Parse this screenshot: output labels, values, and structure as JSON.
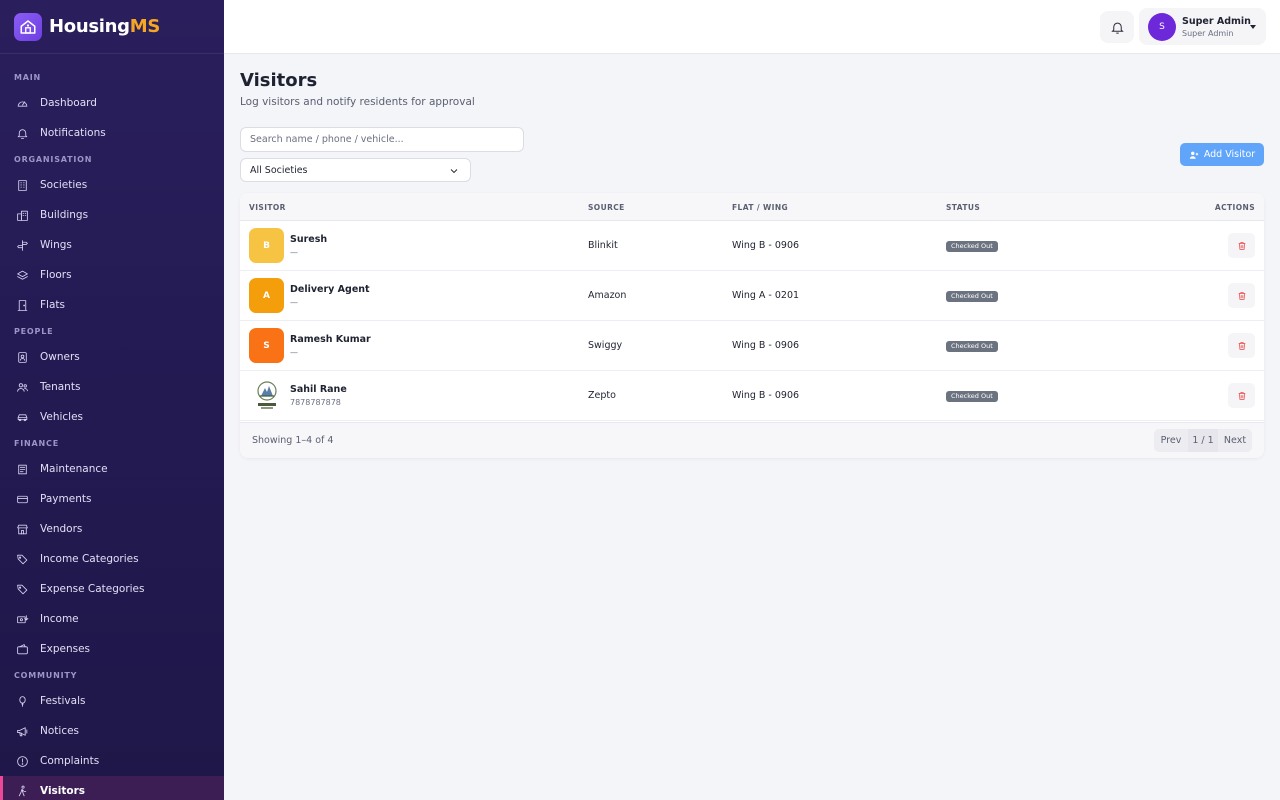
{
  "brand": {
    "name_main": "Housing",
    "name_accent": "MS"
  },
  "sidebar": {
    "sections": [
      {
        "title": "MAIN",
        "items": [
          {
            "label": "Dashboard",
            "icon": "gauge-icon"
          },
          {
            "label": "Notifications",
            "icon": "bell-icon"
          }
        ]
      },
      {
        "title": "ORGANISATION",
        "items": [
          {
            "label": "Societies",
            "icon": "building-icon"
          },
          {
            "label": "Buildings",
            "icon": "city-icon"
          },
          {
            "label": "Wings",
            "icon": "signpost-icon"
          },
          {
            "label": "Floors",
            "icon": "layers-icon"
          },
          {
            "label": "Flats",
            "icon": "door-icon"
          }
        ]
      },
      {
        "title": "PEOPLE",
        "items": [
          {
            "label": "Owners",
            "icon": "id-badge-icon"
          },
          {
            "label": "Tenants",
            "icon": "users-icon"
          },
          {
            "label": "Vehicles",
            "icon": "car-icon"
          }
        ]
      },
      {
        "title": "FINANCE",
        "items": [
          {
            "label": "Maintenance",
            "icon": "receipt-icon"
          },
          {
            "label": "Payments",
            "icon": "credit-card-icon"
          },
          {
            "label": "Vendors",
            "icon": "store-icon"
          },
          {
            "label": "Income Categories",
            "icon": "tags-icon"
          },
          {
            "label": "Expense Categories",
            "icon": "tags-icon"
          },
          {
            "label": "Income",
            "icon": "money-in-icon"
          },
          {
            "label": "Expenses",
            "icon": "wallet-icon"
          }
        ]
      },
      {
        "title": "COMMUNITY",
        "items": [
          {
            "label": "Festivals",
            "icon": "balloon-icon"
          },
          {
            "label": "Notices",
            "icon": "megaphone-icon"
          },
          {
            "label": "Complaints",
            "icon": "alert-circle-icon"
          },
          {
            "label": "Visitors",
            "icon": "person-walking-icon",
            "active": true
          }
        ]
      }
    ]
  },
  "topbar": {
    "user_initial": "S",
    "user_name": "Super Admin",
    "user_role": "Super Admin"
  },
  "main": {
    "title": "Visitors",
    "subtitle": "Log visitors and notify residents for approval",
    "search_placeholder": "Search name / phone / vehicle...",
    "society_filter": "All Societies",
    "add_button": "Add Visitor"
  },
  "table": {
    "headers": {
      "visitor": "VISITOR",
      "source": "SOURCE",
      "flat": "FLAT / WING",
      "status": "STATUS",
      "actions": "ACTIONS"
    },
    "rows": [
      {
        "initial": "B",
        "avatar_color": "#f6c343",
        "name": "Suresh",
        "phone": "—",
        "source": "Blinkit",
        "flat": "Wing B - 0906",
        "status": "Checked Out"
      },
      {
        "initial": "A",
        "avatar_color": "#f59e0b",
        "name": "Delivery Agent",
        "phone": "—",
        "source": "Amazon",
        "flat": "Wing A - 0201",
        "status": "Checked Out"
      },
      {
        "initial": "S",
        "avatar_color": "#f97316",
        "name": "Ramesh Kumar",
        "phone": "—",
        "source": "Swiggy",
        "flat": "Wing B - 0906",
        "status": "Checked Out"
      },
      {
        "initial": "",
        "avatar_color": "#ffffff",
        "name": "Sahil Rane",
        "phone": "7878787878",
        "source": "Zepto",
        "flat": "Wing B - 0906",
        "status": "Checked Out",
        "photo": true
      }
    ],
    "footer": {
      "showing": "Showing 1–4 of 4",
      "prev": "Prev",
      "page": "1 / 1",
      "next": "Next"
    }
  },
  "colors": {
    "sidebar_bg": "#2a1f5c",
    "accent_orange": "#f5a623",
    "primary_blue": "#60a5fa",
    "active_pink": "#ec4899",
    "badge_gray": "#6b7280",
    "delete_red": "#ef4444"
  }
}
